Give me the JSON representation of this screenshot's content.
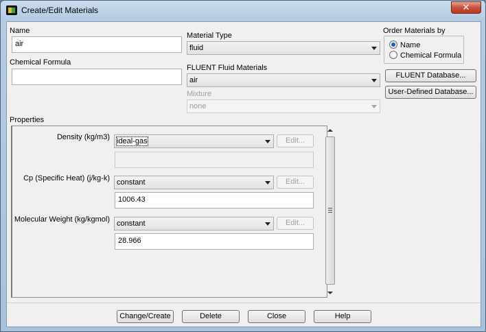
{
  "window": {
    "title": "Create/Edit Materials",
    "close_glyph": "✕"
  },
  "name": {
    "label": "Name",
    "value": "air"
  },
  "chemical_formula": {
    "label": "Chemical Formula",
    "value": ""
  },
  "material_type": {
    "label": "Material Type",
    "value": "fluid"
  },
  "fluent_fluid_materials": {
    "label": "FLUENT Fluid Materials",
    "value": "air"
  },
  "mixture": {
    "label": "Mixture",
    "value": "none",
    "enabled": false
  },
  "order_by": {
    "label": "Order Materials by",
    "options": [
      {
        "label": "Name",
        "selected": true
      },
      {
        "label": "Chemical Formula",
        "selected": false
      }
    ]
  },
  "side_buttons": {
    "fluent_database": "FLUENT Database...",
    "user_defined_database": "User-Defined Database..."
  },
  "properties": {
    "label": "Properties",
    "rows": [
      {
        "label": "Density (kg/m3)",
        "method": "ideal-gas",
        "edit_label": "Edit...",
        "value": ""
      },
      {
        "label": "Cp (Specific Heat) (j/kg-k)",
        "method": "constant",
        "edit_label": "Edit...",
        "value": "1006.43"
      },
      {
        "label": "Molecular Weight (kg/kgmol)",
        "method": "constant",
        "edit_label": "Edit...",
        "value": "28.966"
      }
    ]
  },
  "footer": {
    "change_create": "Change/Create",
    "delete": "Delete",
    "close": "Close",
    "help": "Help"
  },
  "icons": {
    "app": "fluent-app-icon",
    "close": "close-icon",
    "combo_arrow": "chevron-down-icon"
  },
  "colors": {
    "title_gradient_top": "#c9dced",
    "client_bg": "#f0f0f0",
    "close_button": "#c8503a",
    "radio_dot": "#1e5fb3"
  }
}
